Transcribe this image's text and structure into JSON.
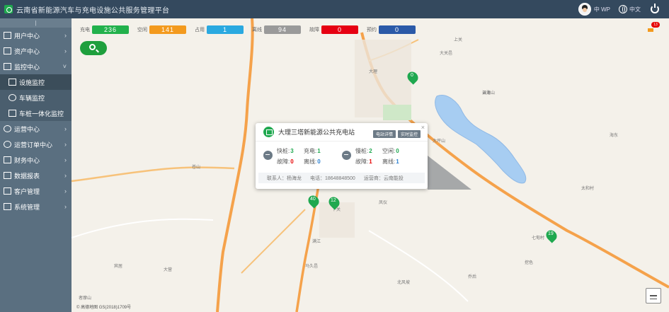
{
  "header": {
    "title": "云南省新能源汽车与充电设施公共服务管理平台",
    "user_name": "中 WP",
    "lang_label": "中文"
  },
  "sidebar": {
    "top_label": "|",
    "items": [
      {
        "label": "用户中心",
        "icon": "grid-icon",
        "expanded": false
      },
      {
        "label": "资产中心",
        "icon": "home-icon",
        "expanded": false
      },
      {
        "label": "监控中心",
        "icon": "grid-icon",
        "expanded": true
      },
      {
        "label": "运营中心",
        "icon": "plug-icon",
        "expanded": false
      },
      {
        "label": "运营订单中心",
        "icon": "chart-icon",
        "expanded": false
      },
      {
        "label": "财务中心",
        "icon": "grid-icon",
        "expanded": false
      },
      {
        "label": "数据报表",
        "icon": "grid-icon",
        "expanded": false
      },
      {
        "label": "客户管理",
        "icon": "grid-icon",
        "expanded": false
      },
      {
        "label": "系统管理",
        "icon": "grid-icon",
        "expanded": false
      }
    ],
    "submenu": [
      {
        "label": "设施监控",
        "icon": "grid-icon",
        "active": true
      },
      {
        "label": "车辆监控",
        "icon": "car-icon",
        "active": false
      },
      {
        "label": "车桩一体化监控",
        "icon": "grid-icon",
        "active": false
      }
    ]
  },
  "stats": [
    {
      "label": "充电",
      "value": "236",
      "color": "#22b14c"
    },
    {
      "label": "空闲",
      "value": "141",
      "color": "#f39a1e"
    },
    {
      "label": "占用",
      "value": "1",
      "color": "#2aa9e0"
    },
    {
      "label": "离线",
      "value": "94",
      "color": "#9a9a9a"
    },
    {
      "label": "故障",
      "value": "0",
      "color": "#e60012"
    },
    {
      "label": "预约",
      "value": "0",
      "color": "#2b5aa8"
    }
  ],
  "popup": {
    "title": "大理三塔新能源公共充电站",
    "btn_detail": "电站详情",
    "btn_monitor": "实时监控",
    "close": "×",
    "groups": [
      {
        "type": "slow",
        "icon": "ac-icon",
        "rows": [
          {
            "label": "快桩:",
            "value": "3",
            "tone": "green"
          },
          {
            "label": "充电:",
            "value": "1",
            "tone": "green"
          },
          {
            "label": "故障:",
            "value": "0",
            "tone": "red"
          },
          {
            "label": "离线:",
            "value": "0",
            "tone": "blue"
          }
        ]
      },
      {
        "type": "fast",
        "icon": "dc-icon",
        "rows": [
          {
            "label": "慢桩:",
            "value": "2",
            "tone": "green"
          },
          {
            "label": "空闲:",
            "value": "0",
            "tone": "green"
          },
          {
            "label": "故障:",
            "value": "1",
            "tone": "red"
          },
          {
            "label": "离线:",
            "value": "1",
            "tone": "blue"
          }
        ]
      }
    ],
    "contact": "联系人：杨海龙",
    "phone": "电话：18648848500",
    "operator": "运营商：云南能投"
  },
  "map": {
    "copyright": "© 高德地图 GS(2018)1709号",
    "labels": [
      "大理",
      "下关",
      "苍山",
      "洱海",
      "凤仪",
      "大关邑",
      "太和村",
      "满江",
      "宾居",
      "大营",
      "者摩山",
      "北风坡",
      "乔后",
      "大坪山",
      "七甸村",
      "云龙山",
      "海东",
      "挖色",
      "上关",
      "马久邑"
    ],
    "markers": [
      "0",
      "40",
      "12",
      "19"
    ]
  },
  "message_badge": "13"
}
